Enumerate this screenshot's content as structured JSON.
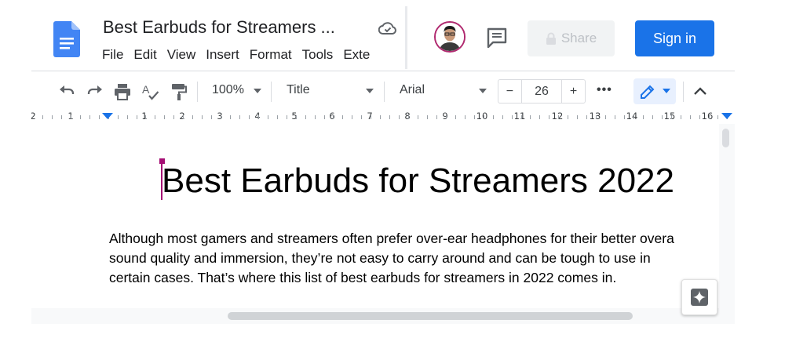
{
  "header": {
    "doc_title": "Best Earbuds for Streamers ...",
    "menu": [
      "File",
      "Edit",
      "View",
      "Insert",
      "Format",
      "Tools",
      "Exte"
    ],
    "share_label": "Share",
    "signin_label": "Sign in"
  },
  "toolbar": {
    "zoom": "100%",
    "style": "Title",
    "font": "Arial",
    "font_size": "26",
    "minus": "−",
    "plus": "+",
    "more": "•••"
  },
  "ruler": {
    "labels": [
      "2",
      "1",
      "1",
      "2",
      "3",
      "4",
      "5",
      "6",
      "7",
      "8",
      "9",
      "10",
      "11",
      "12",
      "13",
      "14",
      "15",
      "16"
    ]
  },
  "document": {
    "heading": "Best Earbuds for Streamers 2022",
    "paragraph_lines": [
      "Although most gamers and streamers often prefer over-ear headphones for their better overa",
      "sound quality and immersion, they’re not easy to carry around and can be tough to use in",
      "certain cases. That’s where this list of best earbuds for streamers in 2022 comes in."
    ]
  },
  "colors": {
    "accent": "#1a73e8",
    "cursor": "#a50e74",
    "doc_icon": "#4285f4"
  },
  "icons": [
    "docs-logo-icon",
    "cloud-saved-icon",
    "avatar",
    "comment-icon",
    "lock-icon",
    "undo-icon",
    "redo-icon",
    "print-icon",
    "spellcheck-icon",
    "paint-format-icon",
    "edit-pencil-icon",
    "collapse-chevron-icon",
    "explore-icon"
  ]
}
